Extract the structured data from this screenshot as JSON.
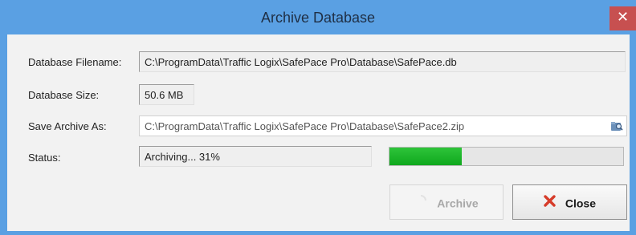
{
  "window": {
    "title": "Archive Database",
    "close_glyph": "✕"
  },
  "form": {
    "filename_label": "Database Filename:",
    "filename_value": "C:\\ProgramData\\Traffic Logix\\SafePace Pro\\Database\\SafePace.db",
    "size_label": "Database Size:",
    "size_value": "50.6 MB",
    "save_label": "Save Archive As:",
    "save_value": "C:\\ProgramData\\Traffic Logix\\SafePace Pro\\Database\\SafePace2.zip",
    "status_label": "Status:",
    "status_value": "Archiving... 31%",
    "progress_percent": 31
  },
  "buttons": {
    "archive_label": "Archive",
    "close_label": "Close"
  },
  "icons": {
    "browse": "folder-search-icon",
    "archive": "spinner-icon",
    "close": "red-x-icon"
  },
  "colors": {
    "title_bar": "#5aa0e3",
    "close_button": "#c75050",
    "progress": "#11aa1f",
    "close_x": "#d63c2a"
  }
}
